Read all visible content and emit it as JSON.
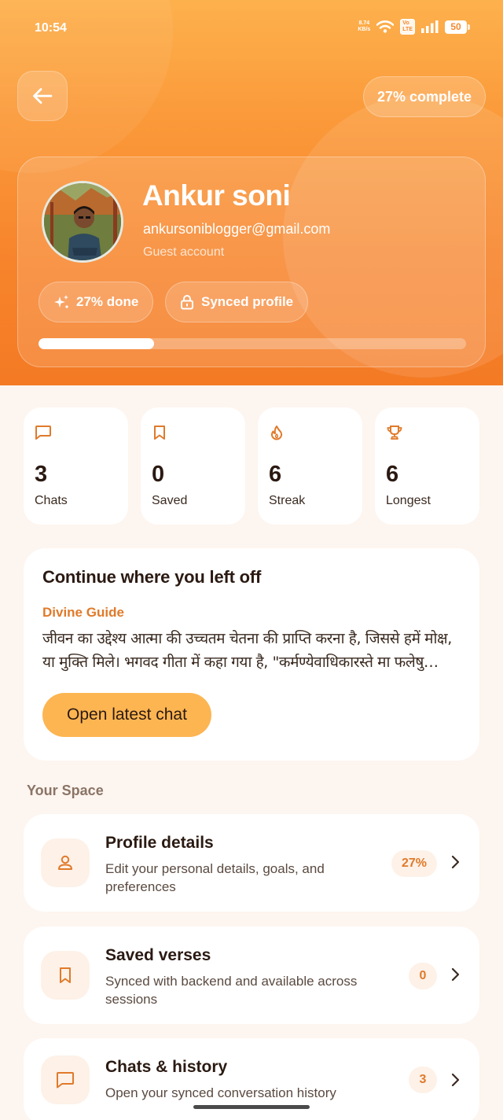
{
  "status_bar": {
    "time": "10:54",
    "net_speed_value": "8.74",
    "net_speed_unit": "KB/s",
    "volte_top": "Vo",
    "volte_bottom": "LTE",
    "battery": "50"
  },
  "header": {
    "complete_label": "27% complete"
  },
  "profile": {
    "name": "Ankur soni",
    "email": "ankursoniblogger@gmail.com",
    "account_type": "Guest account",
    "done_chip": "27% done",
    "synced_chip": "Synced profile",
    "progress_fraction": 0.27
  },
  "stats": [
    {
      "icon": "chat-bubble-icon",
      "value": "3",
      "label": "Chats"
    },
    {
      "icon": "bookmark-icon",
      "value": "0",
      "label": "Saved"
    },
    {
      "icon": "flame-icon",
      "value": "6",
      "label": "Streak"
    },
    {
      "icon": "trophy-icon",
      "value": "6",
      "label": "Longest"
    }
  ],
  "continue_card": {
    "title": "Continue where you left off",
    "guide": "Divine Guide",
    "snippet": "जीवन का उद्देश्य आत्मा की उच्चतम चेतना की प्राप्ति करना है, जिससे हमें मोक्ष, या मुक्ति मिले। भगवद गीता में कहा गया है, \"कर्मण्येवाधिकारस्ते मा फलेषु कदाचन\"",
    "button": "Open latest chat"
  },
  "your_space": {
    "title": "Your Space",
    "items": [
      {
        "icon": "user-icon",
        "title": "Profile details",
        "desc": "Edit your personal details, goals, and preferences",
        "badge": "27%"
      },
      {
        "icon": "bookmark-icon",
        "title": "Saved verses",
        "desc": "Synced with backend and available across sessions",
        "badge": "0"
      },
      {
        "icon": "chat-bubble-icon",
        "title": "Chats & history",
        "desc": "Open your synced conversation history",
        "badge": "3"
      }
    ]
  },
  "colors": {
    "accent": "#f58a30",
    "accent_text": "#e07a2a",
    "button": "#fdb552",
    "page_bg": "#fdf5ef"
  }
}
